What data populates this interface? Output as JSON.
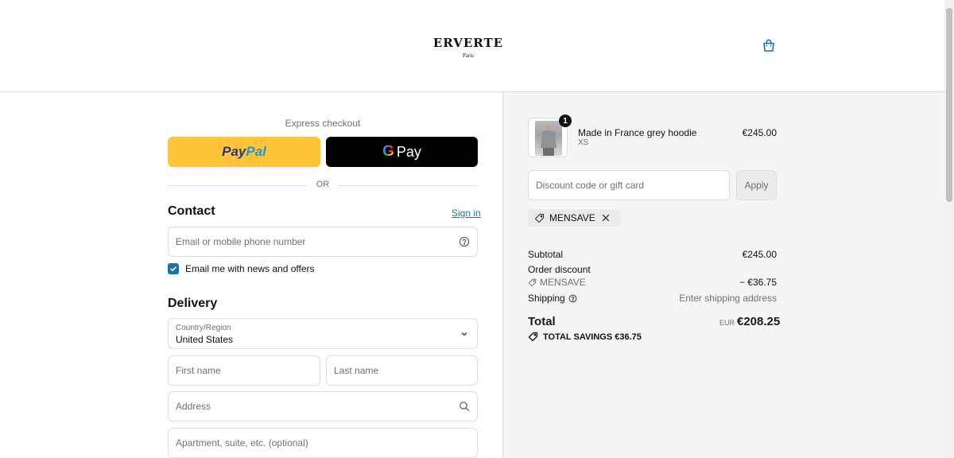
{
  "header": {
    "brand": "ERVERTE",
    "brand_sub": "Paris"
  },
  "express": {
    "label": "Express checkout",
    "paypal_part1": "Pay",
    "paypal_part2": "Pal",
    "gpay_g": "G",
    "gpay_label": "Pay",
    "or_label": "OR"
  },
  "contact": {
    "title": "Contact",
    "signin": "Sign in",
    "email_placeholder": "Email or mobile phone number",
    "newsletter_label": "Email me with news and offers",
    "newsletter_checked": true
  },
  "delivery": {
    "title": "Delivery",
    "country_label": "Country/Region",
    "country_value": "United States",
    "first_name_placeholder": "First name",
    "last_name_placeholder": "Last name",
    "address_placeholder": "Address",
    "apartment_placeholder": "Apartment, suite, etc. (optional)"
  },
  "summary": {
    "product": {
      "name": "Made in France grey hoodie",
      "variant": "XS",
      "price": "€245.00",
      "quantity": "1"
    },
    "discount_placeholder": "Discount code or gift card",
    "apply_label": "Apply",
    "applied_code": "MENSAVE",
    "subtotal_label": "Subtotal",
    "subtotal_value": "€245.00",
    "order_discount_label": "Order discount",
    "discount_code": "MENSAVE",
    "discount_value": "− €36.75",
    "shipping_label": "Shipping",
    "shipping_value": "Enter shipping address",
    "total_label": "Total",
    "total_currency": "EUR",
    "total_value": "€208.25",
    "savings_label": "TOTAL SAVINGS",
    "savings_value": "€36.75"
  },
  "colors": {
    "accent": "#1773b0",
    "paypal_yellow": "#ffc439",
    "summary_bg": "#f5f5f5"
  }
}
